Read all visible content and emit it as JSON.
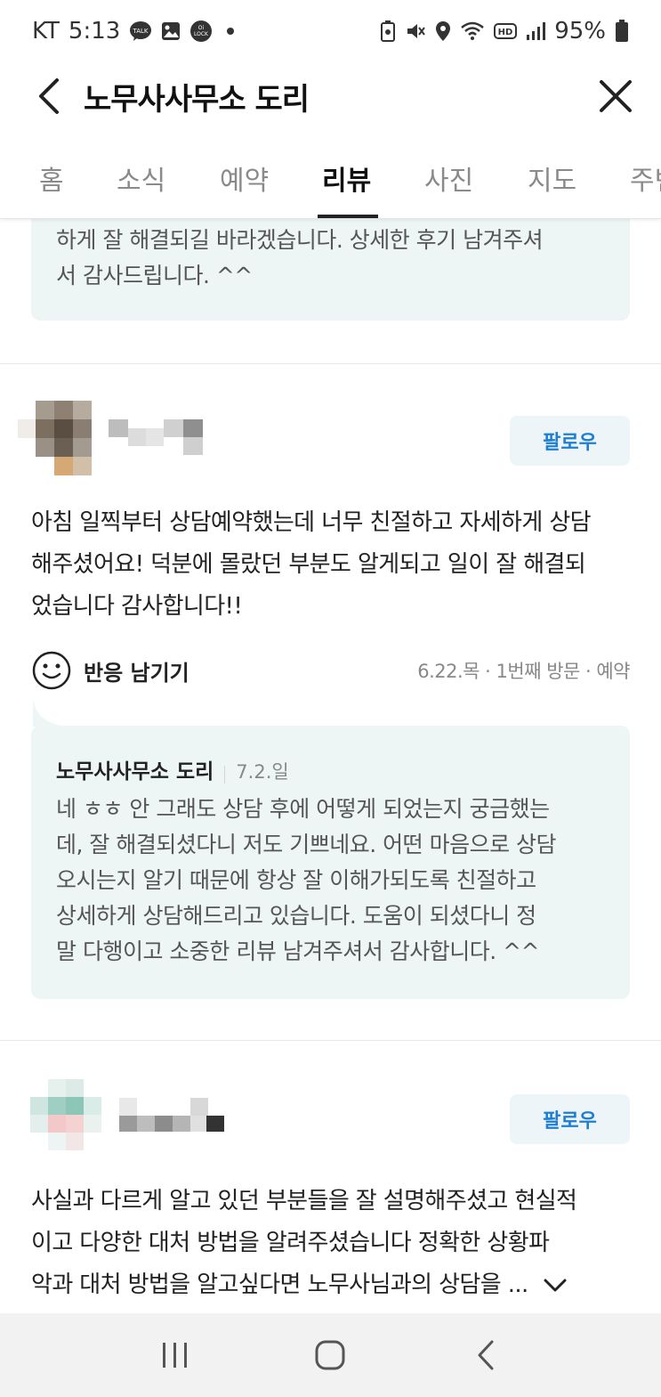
{
  "status_bar": {
    "carrier": "KT",
    "time": "5:13",
    "battery": "95%"
  },
  "header": {
    "title": "노무사사무소 도리"
  },
  "tabs": [
    {
      "label": "홈"
    },
    {
      "label": "소식"
    },
    {
      "label": "예약"
    },
    {
      "label": "리뷰",
      "active": true
    },
    {
      "label": "사진"
    },
    {
      "label": "지도"
    },
    {
      "label": "주변"
    }
  ],
  "top_reply": {
    "lines": [
      "하게 잘 해결되길 바라겠습니다. 상세한 후기 남겨주셔",
      "서 감사드립니다. ^^"
    ]
  },
  "review1": {
    "follow_label": "팔로우",
    "lines": [
      "아침 일찍부터 상담예약했는데 너무 친절하고 자세하게 상담",
      "해주셨어요! 덕분에 몰랐던 부분도 알게되고 일이 잘 해결되",
      "었습니다 감사합니다!!"
    ],
    "react_label": "반응 남기기",
    "visit_meta": "6.22.목 · 1번째 방문 · 예약",
    "reply": {
      "owner": "노무사사무소 도리",
      "date": "7.2.일",
      "lines": [
        "네 ㅎㅎ 안 그래도 상담 후에 어떻게 되었는지 궁금했는",
        "데, 잘 해결되셨다니 저도 기쁘네요. 어떤 마음으로 상담",
        "오시는지 알기 때문에 항상 잘 이해가되도록 친절하고",
        "상세하게 상담해드리고 있습니다. 도움이 되셨다니 정",
        "말 다행이고 소중한 리뷰 남겨주셔서 감사합니다. ^^"
      ]
    }
  },
  "review2": {
    "follow_label": "팔로우",
    "lines": [
      "사실과 다르게 알고 있던 부분들을 잘 설명해주셨고 현실적",
      "이고 다양한 대처 방법을 알려주셨습니다 정확한 상황파",
      "악과 대처 방법을 알고싶다면 노무사님과의 상담을 ..."
    ]
  },
  "colors": {
    "accent": "#1e7ed4",
    "reply_bg": "#eef5f5",
    "follow_bg": "#eef5f8"
  },
  "icons": [
    "talk-icon",
    "gallery-icon",
    "lock-icon",
    "battery-saver-icon",
    "mute-icon",
    "location-icon",
    "wifi-icon",
    "hd-icon",
    "signal-icon",
    "battery-icon",
    "back-arrow-icon",
    "close-icon",
    "smile-icon",
    "chevron-down-icon",
    "recent-apps-icon",
    "home-icon",
    "back-nav-icon"
  ]
}
